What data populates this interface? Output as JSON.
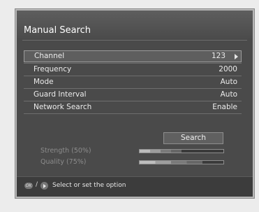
{
  "title": "Manual Search",
  "rows": [
    {
      "label": "Channel",
      "value": "123"
    },
    {
      "label": "Frequency",
      "value": "2000"
    },
    {
      "label": "Mode",
      "value": "Auto"
    },
    {
      "label": "Guard Interval",
      "value": "Auto"
    },
    {
      "label": "Network Search",
      "value": "Enable"
    }
  ],
  "search_label": "Search",
  "meters": {
    "strength": {
      "label": "Strength (50%)",
      "fraction": 0.5
    },
    "quality": {
      "label": "Quality (75%)",
      "fraction": 0.75
    }
  },
  "footer": {
    "ok_text": "OK",
    "slash": "/",
    "hint": "Select or set the option"
  }
}
